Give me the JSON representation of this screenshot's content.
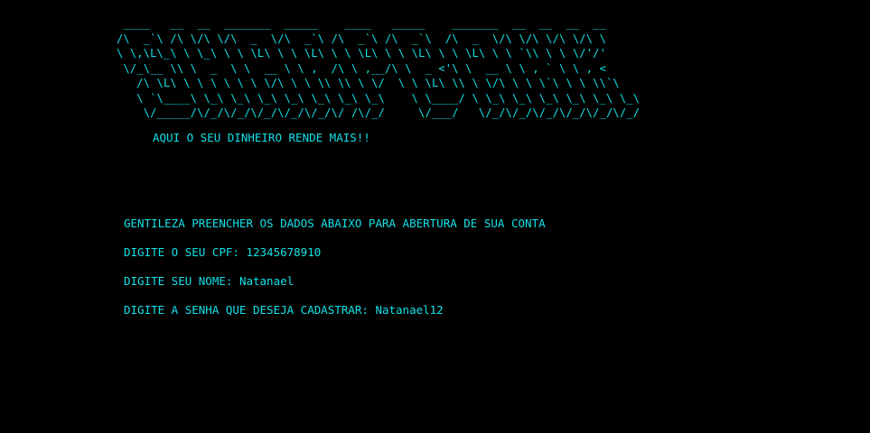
{
  "banner": {
    "lines": [
      " ____   __  __  _______  _____    ____   _____    _______  __  __  __  __",
      "/\\  _`\\ /\\ \\/\\ \\/\\  _  \\/\\  _`\\ /\\  _`\\ /\\  _`\\  /\\  _  \\/\\ \\/\\ \\/\\ \\/\\ \\",
      "\\ \\,\\L\\_\\ \\ \\_\\ \\ \\ \\L\\ \\ \\ \\L\\ \\ \\ \\L\\ \\ \\ \\L\\ \\ \\ \\L\\ \\ \\ `\\\\ \\ \\ \\/'/'",
      " \\/_\\__ \\\\ \\  _  \\ \\  __ \\ \\ ,  /\\ \\ ,__/\\ \\  _ <'\\ \\  __ \\ \\ , ` \\ \\ , <",
      "   /\\ \\L\\ \\ \\ \\ \\ \\ \\ \\/\\ \\ \\ \\\\ \\\\ \\ \\/  \\ \\ \\L\\ \\\\ \\ \\/\\ \\ \\ \\`\\ \\ \\ \\\\`\\",
      "   \\ `\\____\\ \\_\\ \\_\\ \\_\\ \\_\\ \\_\\ \\_\\ \\_\\    \\ \\____/ \\ \\_\\ \\_\\ \\_\\ \\_\\ \\_\\ \\_\\",
      "    \\/_____/\\/_/\\/_/\\/_/\\/_/\\/_/\\/ /\\/_/     \\/___/   \\/_/\\/_/\\/_/\\/_/\\/_/\\/_/"
    ]
  },
  "tagline": "AQUI O SEU DINHEIRO RENDE MAIS!!",
  "form": {
    "intro": "GENTILEZA PREENCHER OS DADOS ABAIXO PARA ABERTURA DE SUA CONTA",
    "cpf_prompt": "DIGITE O SEU CPF: ",
    "cpf_value": "12345678910",
    "name_prompt": "DIGITE SEU NOME: ",
    "name_value": "Natanael",
    "password_prompt": "DIGITE A SENHA QUE DESEJA CADASTRAR: ",
    "password_value": "Natanael12"
  },
  "colors": {
    "background": "#000000",
    "text": "#12e1e8"
  }
}
